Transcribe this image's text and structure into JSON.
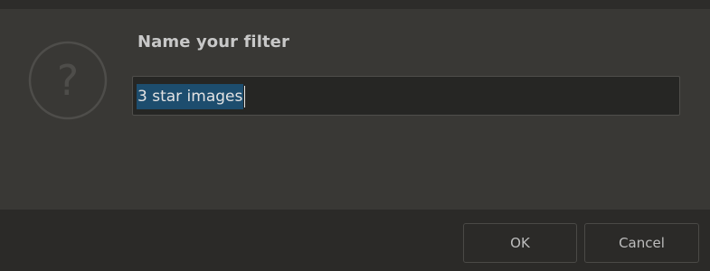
{
  "dialog": {
    "title": "Name your filter",
    "icon": "question-mark-circle-icon",
    "input": {
      "value": "3 star images",
      "selected": true
    },
    "buttons": {
      "ok_label": "OK",
      "cancel_label": "Cancel"
    }
  },
  "colors": {
    "background": "#393835",
    "footer": "#2b2a28",
    "selection": "#1d4d6e",
    "title_text": "#c8c8c8"
  }
}
